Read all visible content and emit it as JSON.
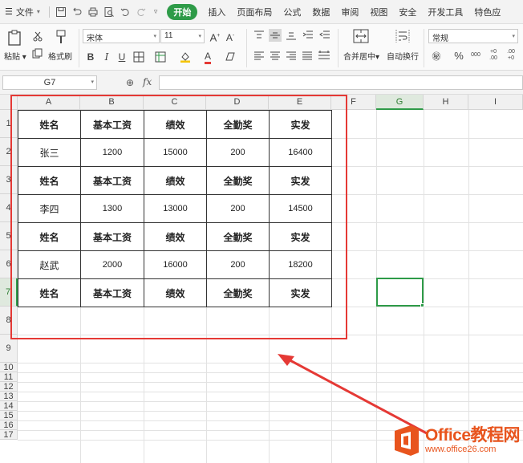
{
  "menubar": {
    "file_label": "文件",
    "tabs": [
      "开始",
      "插入",
      "页面布局",
      "公式",
      "数据",
      "审阅",
      "视图",
      "安全",
      "开发工具",
      "特色应"
    ],
    "active_tab": "开始"
  },
  "ribbon": {
    "paste_label": "粘贴",
    "format_painter_label": "格式刷",
    "font_name": "宋体",
    "font_size": "11",
    "bold": "B",
    "italic": "I",
    "underline": "U",
    "merge_center_label": "合并居中",
    "wrap_text_label": "自动换行",
    "number_format": "常规",
    "percent": "%",
    "thousands": "000",
    "dec_increase": "+0 .00",
    "dec_decrease": ".00 +0"
  },
  "formula_bar": {
    "cell_ref": "G7",
    "fx": "fx",
    "value": ""
  },
  "sheet": {
    "columns": [
      "A",
      "B",
      "C",
      "D",
      "E",
      "F",
      "G",
      "H",
      "I"
    ],
    "rows": [
      "1",
      "2",
      "3",
      "4",
      "5",
      "6",
      "7",
      "8",
      "9",
      "10",
      "11",
      "12",
      "13",
      "14",
      "15",
      "16",
      "17"
    ],
    "selected_column": "G",
    "selected_row": "7",
    "table": [
      [
        "姓名",
        "基本工资",
        "绩效",
        "全勤奖",
        "实发"
      ],
      [
        "张三",
        "1200",
        "15000",
        "200",
        "16400"
      ],
      [
        "姓名",
        "基本工资",
        "绩效",
        "全勤奖",
        "实发"
      ],
      [
        "李四",
        "1300",
        "13000",
        "200",
        "14500"
      ],
      [
        "姓名",
        "基本工资",
        "绩效",
        "全勤奖",
        "实发"
      ],
      [
        "赵武",
        "2000",
        "16000",
        "200",
        "18200"
      ],
      [
        "姓名",
        "基本工资",
        "绩效",
        "全勤奖",
        "实发"
      ]
    ]
  },
  "watermark": {
    "title": "Office教程网",
    "url": "www.office26.com"
  },
  "colors": {
    "accent": "#2e9b48",
    "annotation": "#e53935",
    "watermark": "#e8541d"
  }
}
